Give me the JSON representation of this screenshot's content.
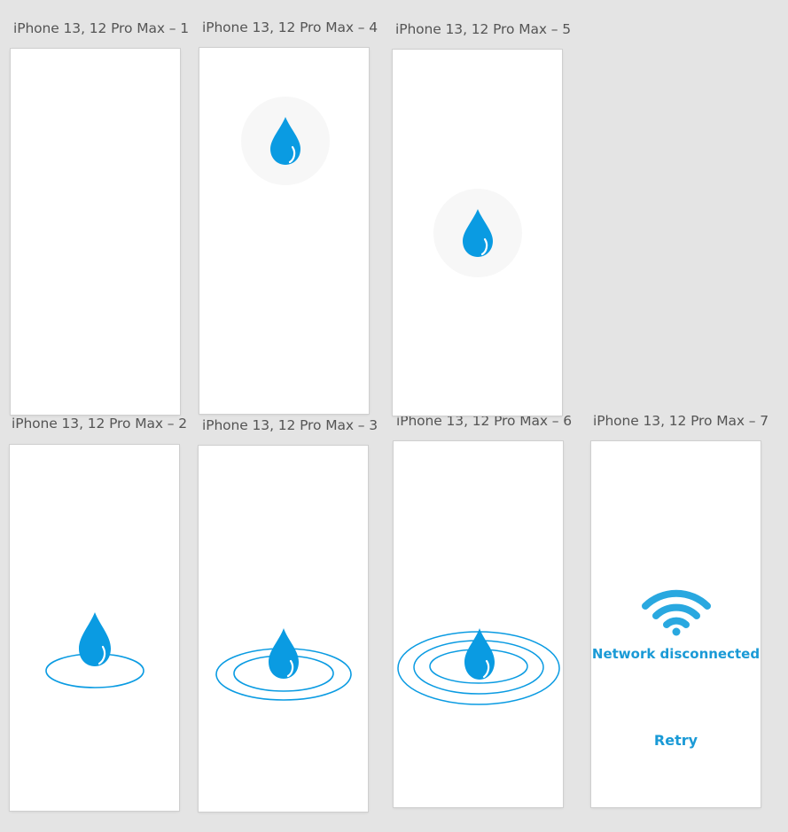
{
  "theme": {
    "canvas_bg": "#e4e4e4",
    "frame_bg": "#ffffff",
    "label_color": "#555555",
    "drop_color": "#0a9be2",
    "ring_color": "#0a9be2",
    "accent_text": "#1a9ad6",
    "wifi_color": "#29a8e0"
  },
  "artboards": [
    {
      "id": "1",
      "label": "iPhone 13, 12 Pro Max – 1",
      "content": "blank"
    },
    {
      "id": "4",
      "label": "iPhone 13, 12 Pro Max – 4",
      "content": "drop-in-circle"
    },
    {
      "id": "5",
      "label": "iPhone 13, 12 Pro Max – 5",
      "content": "drop-in-circle"
    },
    {
      "id": "2",
      "label": "iPhone 13, 12 Pro Max – 2",
      "content": "drop-with-ripples",
      "ripple_count": 1
    },
    {
      "id": "3",
      "label": "iPhone 13, 12 Pro Max – 3",
      "content": "drop-with-ripples",
      "ripple_count": 2
    },
    {
      "id": "6",
      "label": "iPhone 13, 12 Pro Max – 6",
      "content": "drop-with-ripples",
      "ripple_count": 3
    },
    {
      "id": "7",
      "label": "iPhone 13, 12 Pro Max – 7",
      "content": "network-error"
    }
  ],
  "network_error": {
    "icon": "wifi-icon",
    "message": "Network disconnected",
    "retry_label": "Retry"
  }
}
